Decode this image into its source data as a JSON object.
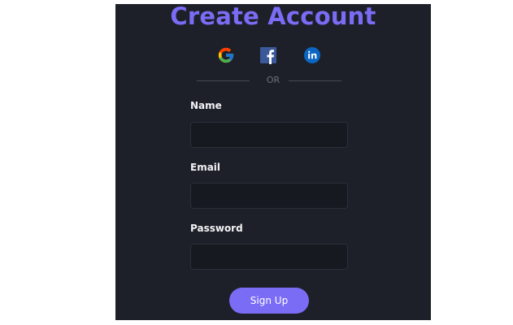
{
  "form": {
    "title": "Create Account",
    "divider_text": "OR",
    "social_buttons": [
      {
        "icon": "google-icon",
        "color": "#4285F4"
      },
      {
        "icon": "facebook-icon",
        "color": "#3b5998"
      },
      {
        "icon": "linkedin-icon",
        "color": "#0a66c2"
      }
    ],
    "fields": {
      "name": {
        "label": "Name",
        "value": "",
        "placeholder": ""
      },
      "email": {
        "label": "Email",
        "value": "",
        "placeholder": ""
      },
      "password": {
        "label": "Password",
        "value": "",
        "placeholder": ""
      }
    },
    "submit_label": "Sign Up"
  },
  "colors": {
    "accent": "#7b6cf6",
    "panel_background": "#1e2029",
    "input_background": "#171921",
    "page_background": "#ffffff"
  }
}
